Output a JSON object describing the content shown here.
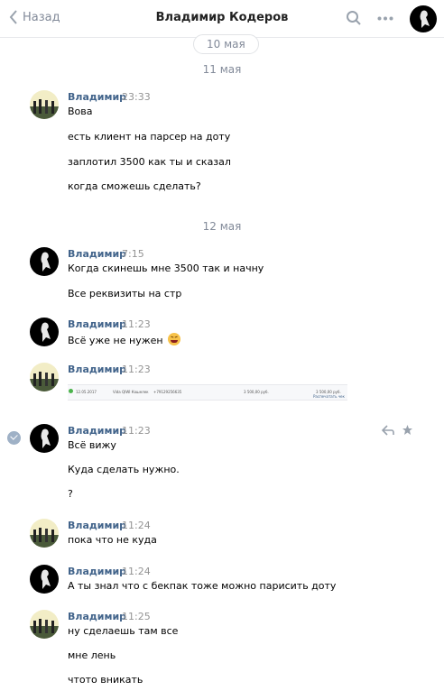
{
  "header": {
    "back_label": "Назад",
    "title": "Владимир Кодеров"
  },
  "dates": {
    "d1": "10 мая",
    "d2": "11 мая",
    "d3": "12 мая"
  },
  "messages": [
    {
      "sender": "Владимир",
      "time": "23:33",
      "lines": [
        "Вова",
        "есть клиент на парсер на доту",
        "заплотил 3500 как ты и сказал",
        "когда сможешь сделать?"
      ]
    },
    {
      "sender": "Владимир",
      "time": "7:15",
      "lines": [
        "Когда скинешь мне 3500 так и начну",
        "Все реквизиты на стр"
      ]
    },
    {
      "sender": "Владимир",
      "time": "11:23",
      "lines": [
        "Всё уже не нужен"
      ]
    },
    {
      "sender": "Владимир",
      "time": "11:23",
      "attachment": {
        "c1": "12.05.2017",
        "c2": "Vida QIWI Кошелек",
        "c3": "+79129256635",
        "c4": "3 500,00 руб.",
        "c5": "3 500,00 руб.",
        "c6": "Распечатать чек"
      }
    },
    {
      "sender": "Владимир",
      "time": "11:23",
      "lines": [
        "Всё вижу",
        "Куда сделать нужно.",
        "?"
      ]
    },
    {
      "sender": "Владимир",
      "time": "11:24",
      "lines": [
        "пока что не куда"
      ]
    },
    {
      "sender": "Владимир",
      "time": "11:24",
      "lines": [
        "А ты знал что с бекпак тоже можно парисить доту"
      ]
    },
    {
      "sender": "Владимир",
      "time": "11:25",
      "lines": [
        "ну сделаешь там все",
        "мне лень",
        "чтото вникать"
      ]
    }
  ],
  "colors": {
    "link": "#42648b",
    "muted": "#828a99"
  }
}
